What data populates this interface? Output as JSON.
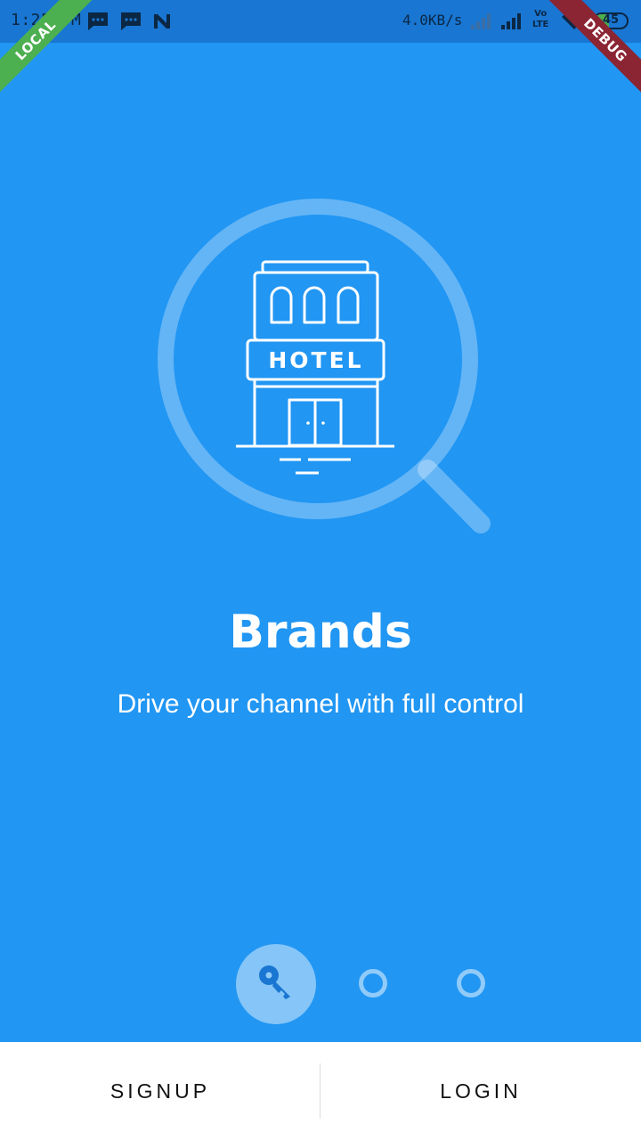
{
  "status_bar": {
    "time": "1:25 PM",
    "network_speed": "4.0KB/s",
    "volte_line1": "Vo",
    "volte_line2": "LTE",
    "battery": "45",
    "icons": [
      "message-icon",
      "message-icon",
      "n-app-icon",
      "signal-icon",
      "signal-icon",
      "wifi-icon",
      "battery-icon"
    ]
  },
  "banners": {
    "left": "LOCAL",
    "right": "DEBUG"
  },
  "illustration": {
    "sign_text": "HOTEL",
    "icon": "hotel-search-icon"
  },
  "content": {
    "title": "Brands",
    "subtitle": "Drive your channel with full control"
  },
  "pager": {
    "active_icon": "key-icon",
    "page_count": 3,
    "active_index": 0
  },
  "bottom_bar": {
    "signup_label": "SIGNUP",
    "login_label": "LOGIN"
  },
  "colors": {
    "background": "#2196F3",
    "status_bar": "#1976D2",
    "local_ribbon": "#4CAF50",
    "debug_ribbon": "#8B2533"
  }
}
